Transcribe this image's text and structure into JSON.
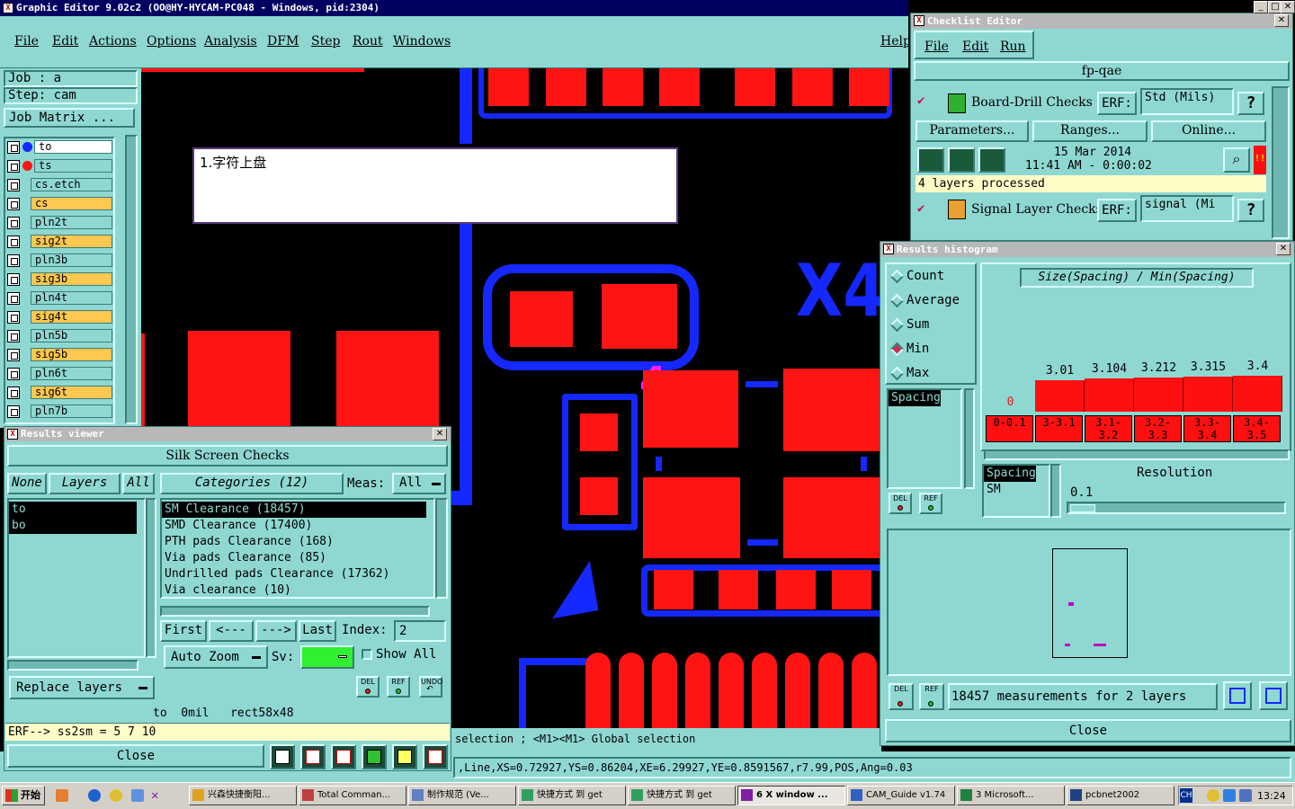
{
  "main_window": {
    "title": "Graphic Editor 9.02c2  (OO@HY-HYCAM-PC048 - Windows, pid:2304)",
    "menu": [
      "File",
      "Edit",
      "Actions",
      "Options",
      "Analysis",
      "DFM",
      "Step",
      "Rout",
      "Windows"
    ],
    "help": "Help",
    "job_label": "Job : a",
    "step_label": "Step: cam",
    "job_matrix": "Job Matrix ...",
    "layers": [
      {
        "name": "to",
        "style": "white"
      },
      {
        "name": "ts",
        "style": "teal"
      },
      {
        "name": "cs.etch",
        "style": "teal"
      },
      {
        "name": "cs",
        "style": "yellow"
      },
      {
        "name": "pln2t",
        "style": "teal"
      },
      {
        "name": "sig2t",
        "style": "yellow"
      },
      {
        "name": "pln3b",
        "style": "teal"
      },
      {
        "name": "sig3b",
        "style": "yellow"
      },
      {
        "name": "pln4t",
        "style": "teal"
      },
      {
        "name": "sig4t",
        "style": "yellow"
      },
      {
        "name": "pln5b",
        "style": "teal"
      },
      {
        "name": "sig5b",
        "style": "yellow"
      },
      {
        "name": "pln6t",
        "style": "teal"
      },
      {
        "name": "sig6t",
        "style": "yellow"
      },
      {
        "name": "pln7b",
        "style": "teal"
      }
    ],
    "note_text": "1.字符上盘",
    "canvas_label": "X4",
    "canvas_marker": "4",
    "selection_hint": "selection ; <M1><M1> Global selection",
    "status_line": ",Line,XS=0.72927,YS=0.86204,XE=6.29927,YE=0.8591567,r7.99,POS,Ang=0.03"
  },
  "checklist_editor": {
    "title": "Checklist Editor",
    "menu": [
      "File",
      "Edit",
      "Run"
    ],
    "checklist_name": "fp-qae",
    "item1": {
      "name": "Board-Drill Checks",
      "erf_label": "ERF:",
      "erf_value": "Std (Mils)",
      "help": "?",
      "parameters": "Parameters...",
      "ranges": "Ranges...",
      "online": "Online...",
      "date": "15 Mar 2014",
      "time": "11:41 AM - 0:00:02",
      "status": "4 layers processed",
      "alert": "!!"
    },
    "item2": {
      "name": "Signal Layer Checks",
      "erf_label": "ERF:",
      "erf_value": "signal (Mi",
      "help": "?"
    }
  },
  "results_viewer": {
    "title": "Results viewer",
    "heading": "Silk Screen Checks",
    "none_btn": "None",
    "layers_btn": "Layers",
    "all_btn": "All",
    "layer_list": [
      "to",
      "bo"
    ],
    "categories_label": "Categories (12)",
    "meas_label": "Meas:",
    "meas_value": "All",
    "categories": [
      "SM Clearance (18457)",
      "SMD Clearance (17400)",
      "PTH pads Clearance (168)",
      "Via pads Clearance (85)",
      "Undrilled pads Clearance (17362)",
      "Via clearance (10)"
    ],
    "nav": {
      "first": "First",
      "prev": "<---",
      "next": "--->",
      "last": "Last",
      "index_label": "Index:",
      "index_value": "2"
    },
    "auto_zoom": "Auto Zoom",
    "sv_label": "Sv:",
    "show_all": "Show All",
    "replace_layers": "Replace layers",
    "info_line": "to  0mil   rect58x48",
    "erf_line": "ERF--> ss2sm = 5 7 10",
    "close": "Close",
    "tools": {
      "del": "DEL",
      "ref": "REF",
      "undo": "UNDO"
    }
  },
  "histogram": {
    "title": "Results histogram",
    "modes": [
      {
        "label": "Count",
        "on": false
      },
      {
        "label": "Average",
        "on": false
      },
      {
        "label": "Sum",
        "on": false
      },
      {
        "label": "Min",
        "on": true
      },
      {
        "label": "Max",
        "on": false
      }
    ],
    "list_item": "Spacing",
    "chart_title": "Size(Spacing) / Min(Spacing)",
    "spacing_label": "Spacing",
    "sm_label": "SM",
    "resolution_label": "Resolution",
    "resolution_value": "0.1",
    "measurements": "18457 measurements for 2 layers",
    "close": "Close",
    "del": "DEL",
    "ref": "REF"
  },
  "chart_data": {
    "type": "bar",
    "title": "Size(Spacing) / Min(Spacing)",
    "categories": [
      "0-0.1",
      "3-3.1",
      "3.1-3.2",
      "3.2-3.3",
      "3.3-3.4",
      "3.4-3.5"
    ],
    "labels": [
      "0",
      "3.01",
      "3.104",
      "3.212",
      "3.315",
      "3.4"
    ],
    "values": [
      0,
      3.01,
      3.104,
      3.212,
      3.315,
      3.4
    ]
  },
  "taskbar": {
    "start": "开始",
    "items": [
      {
        "label": "兴森快捷衡阳...",
        "active": false
      },
      {
        "label": "Total Comman...",
        "active": false
      },
      {
        "label": "制作规范 (Ve...",
        "active": false
      },
      {
        "label": "快捷方式 到 get",
        "active": false
      },
      {
        "label": "快捷方式 到 get",
        "active": false
      },
      {
        "label": "6 X window ...",
        "active": true
      },
      {
        "label": "CAM_Guide v1.74",
        "active": false
      },
      {
        "label": "3 Microsoft...",
        "active": false
      },
      {
        "label": "pcbnet2002",
        "active": false
      }
    ],
    "lang": "CH",
    "clock": "13:24"
  }
}
